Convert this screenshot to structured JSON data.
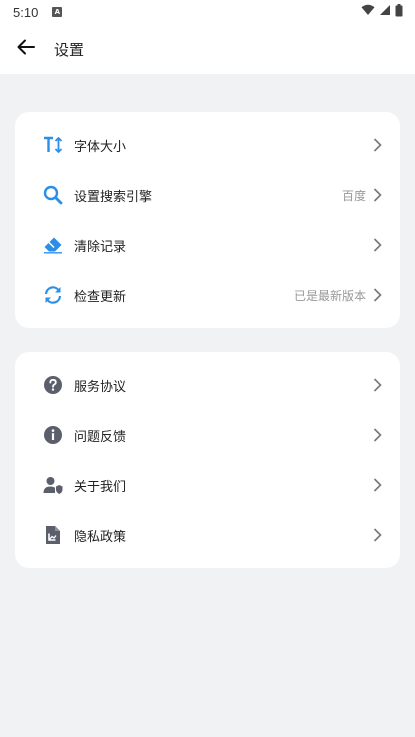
{
  "status_bar": {
    "time": "5:10",
    "notification_icon": "a-box-icon"
  },
  "header": {
    "title": "设置"
  },
  "colors": {
    "accent": "#2b8fe8",
    "gray_icon": "#5a5f6b"
  },
  "group1": [
    {
      "label": "字体大小",
      "value": "",
      "icon": "font-size-icon"
    },
    {
      "label": "设置搜索引擎",
      "value": "百度",
      "icon": "search-icon"
    },
    {
      "label": "清除记录",
      "value": "",
      "icon": "eraser-icon"
    },
    {
      "label": "检查更新",
      "value": "已是最新版本",
      "icon": "refresh-icon"
    }
  ],
  "group2": [
    {
      "label": "服务协议",
      "icon": "question-circle-icon"
    },
    {
      "label": "问题反馈",
      "icon": "info-circle-icon"
    },
    {
      "label": "关于我们",
      "icon": "user-shield-icon"
    },
    {
      "label": "隐私政策",
      "icon": "document-icon"
    }
  ]
}
